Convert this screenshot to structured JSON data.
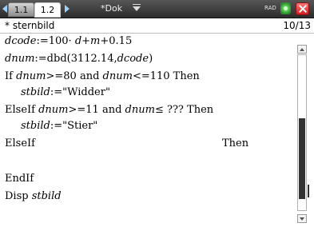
{
  "tabs": {
    "tab1": "1.1",
    "tab2": "1.2"
  },
  "document": {
    "title": "*Dok"
  },
  "status": {
    "angle_mode": "RAD"
  },
  "header": {
    "program": "* sternbild",
    "position": "10/13"
  },
  "code": {
    "l1_var": "dcode",
    "l1_rest": ":=100· ",
    "l1_d": "d",
    "l1_plus": "+",
    "l1_m": "m",
    "l1_end": "+0.15",
    "l2_var": "dnum",
    "l2_fn": ":=dbd(3112.14,",
    "l2_arg": "dcode",
    "l2_end": ")",
    "l3_if": "If ",
    "l3_v1": "dnum",
    "l3_mid": ">=80 and ",
    "l3_v2": "dnum",
    "l3_end": "<=110 Then",
    "l4_var": "stbild",
    "l4_rest": ":=\"Widder\"",
    "l5_elif": "ElseIf ",
    "l5_v1": "dnum",
    "l5_mid": ">=11 and ",
    "l5_v2": "dnum",
    "l5_end": "≤ ??? Then",
    "l6_var": "stbild",
    "l6_rest": ":=\"Stier\"",
    "l7_elif": "ElseIf",
    "l7_then": "Then",
    "l9": "EndIf",
    "l10_disp": "Disp ",
    "l10_var": "stbild"
  }
}
